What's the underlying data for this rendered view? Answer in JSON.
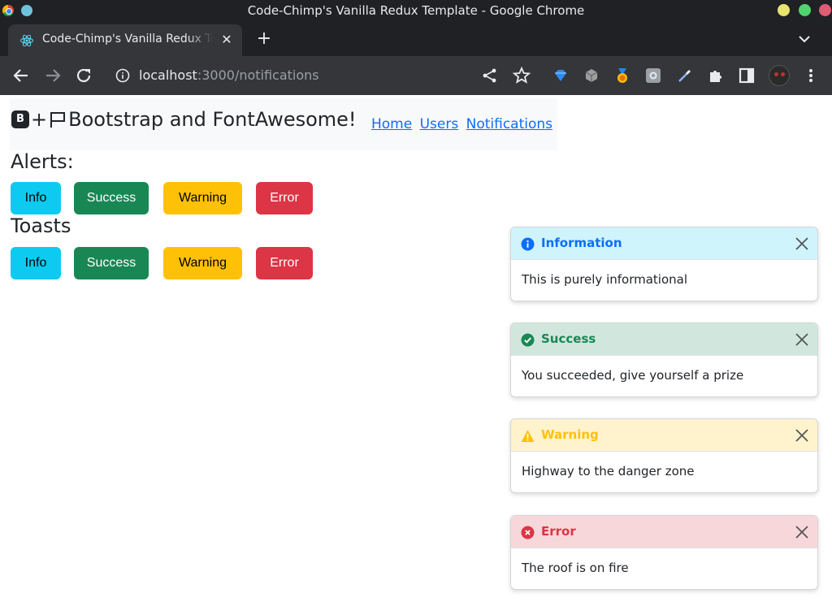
{
  "window": {
    "title": "Code-Chimp's Vanilla Redux Template - Google Chrome"
  },
  "tab": {
    "title": "Code-Chimp's Vanilla Redux Template",
    "close": "✕",
    "new_tab": "+"
  },
  "toolbar": {
    "url_host": "localhost",
    "url_rest": ":3000/notifications"
  },
  "navbar": {
    "brand_b": "B",
    "brand_plus": "+",
    "brand_text": "Bootstrap and FontAwesome!",
    "links": [
      "Home",
      "Users",
      "Notifications"
    ]
  },
  "alerts": {
    "heading": "Alerts:",
    "buttons": [
      "Info",
      "Success",
      "Warning",
      "Error"
    ]
  },
  "toasts_section": {
    "heading": "Toasts",
    "buttons": [
      "Info",
      "Success",
      "Warning",
      "Error"
    ]
  },
  "toasts": [
    {
      "title": "Information",
      "body": "This is purely informational",
      "header_bg": "#cff4fc",
      "title_color": "#0d6efd",
      "icon": "info-circle-icon"
    },
    {
      "title": "Success",
      "body": "You succeeded, give yourself a prize",
      "header_bg": "#d1e7dd",
      "title_color": "#198754",
      "icon": "check-circle-icon"
    },
    {
      "title": "Warning",
      "body": "Highway to the danger zone",
      "header_bg": "#fff3cd",
      "title_color": "#ffc107",
      "icon": "warning-triangle-icon"
    },
    {
      "title": "Error",
      "body": "The roof is on fire",
      "header_bg": "#f8d7da",
      "title_color": "#dc3545",
      "icon": "error-circle-icon"
    }
  ],
  "colors": {
    "info": "#0dcaf0",
    "success": "#198754",
    "warning": "#ffc107",
    "danger": "#dc3545",
    "link": "#0d6efd"
  }
}
